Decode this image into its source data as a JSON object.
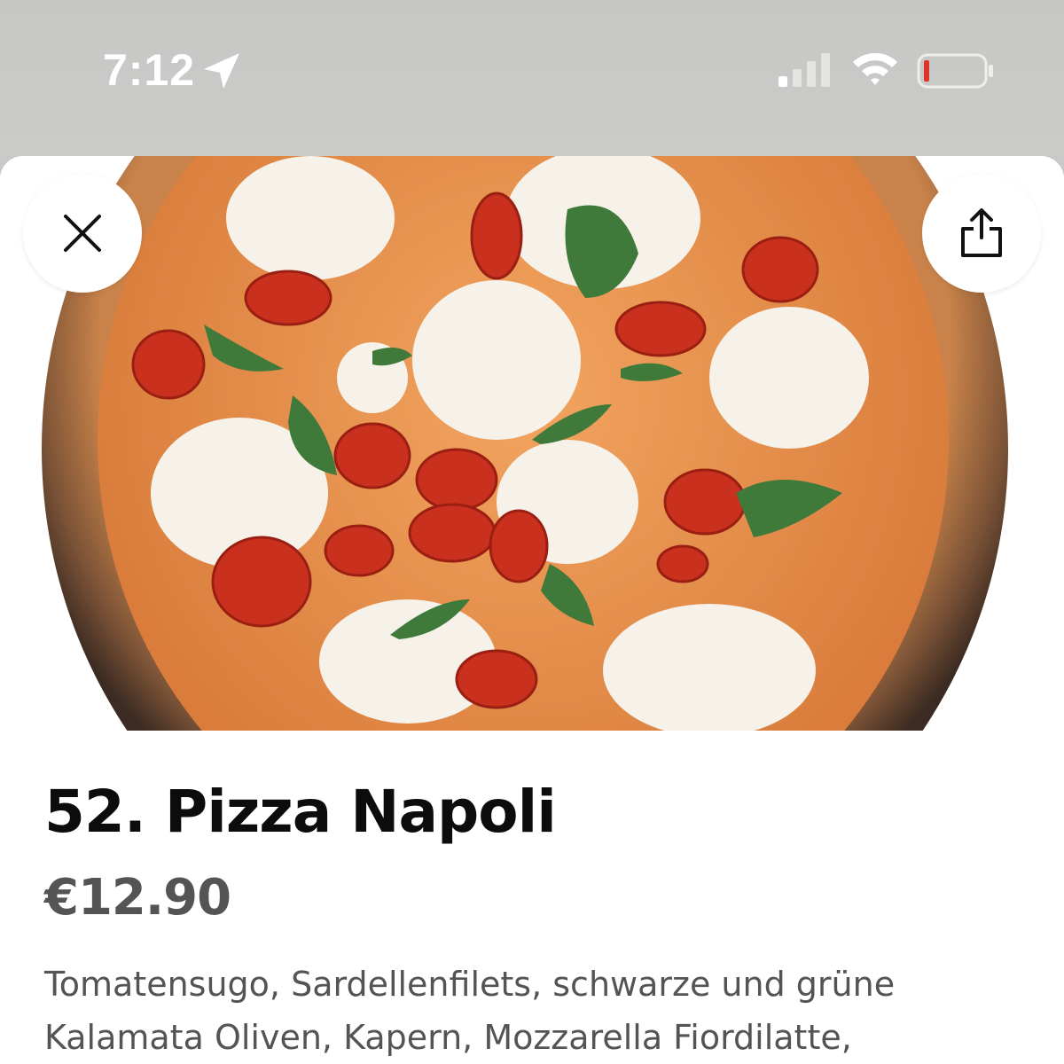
{
  "status_bar": {
    "time": "7:12",
    "icons": [
      "location-arrow-icon",
      "cellular-signal-icon",
      "wifi-icon",
      "battery-low-icon"
    ]
  },
  "header": {
    "close_icon": "close-icon",
    "share_icon": "share-icon"
  },
  "item": {
    "title": "52. Pizza Napoli",
    "price": "€12.90",
    "description": "Tomatensugo, Sardellenfilets, schwarze und grüne Kalamata Oliven, Kapern, Mozzarella Fiordilatte,"
  },
  "colors": {
    "battery_low": "#e0342b",
    "status_text": "#ffffff",
    "title": "#0c0c0c",
    "secondary_text": "#545454"
  }
}
